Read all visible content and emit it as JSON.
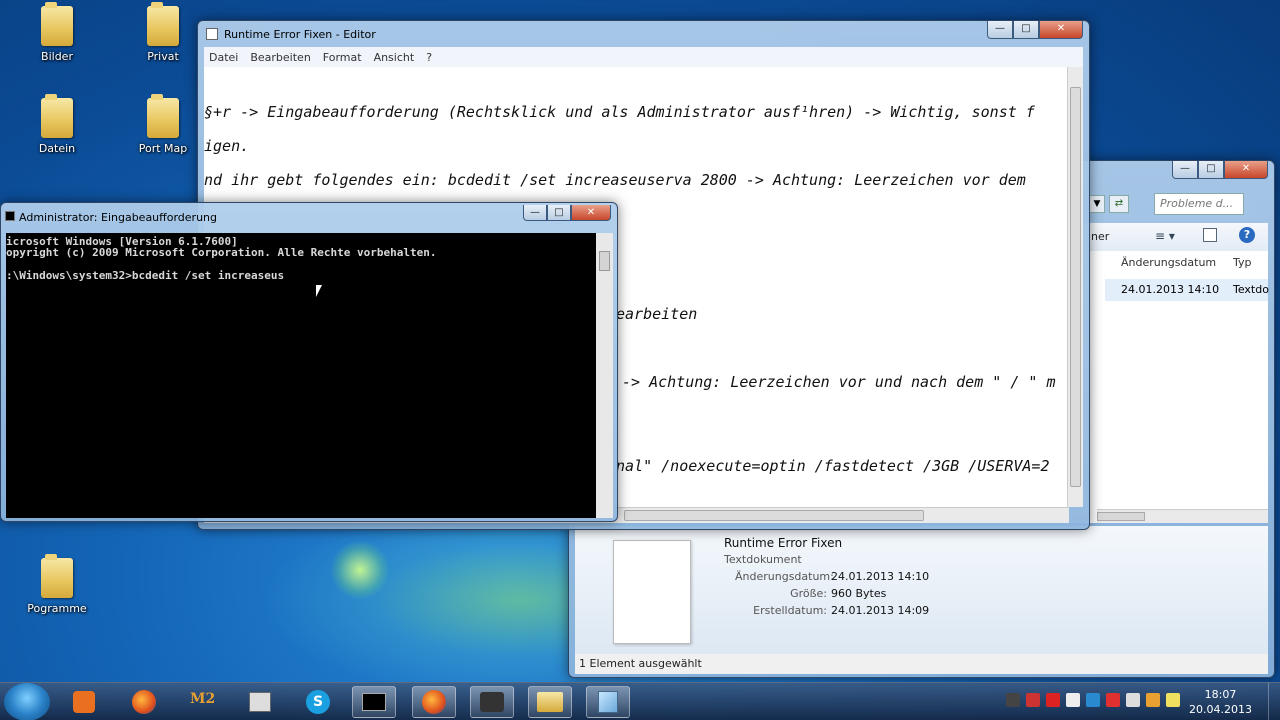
{
  "desktop": {
    "icons": [
      {
        "label": "Bilder"
      },
      {
        "label": "Privat"
      },
      {
        "label": "Datein"
      },
      {
        "label": "Port Map"
      },
      {
        "label": "Pogramme"
      }
    ]
  },
  "editor": {
    "title": "Runtime Error Fixen - Editor",
    "menu": [
      "Datei",
      "Bearbeiten",
      "Format",
      "Ansicht",
      "?"
    ],
    "lines": [
      "§+r -> Eingabeaufforderung (Rechtsklick und als Administrator ausf¹hren) -> Wichtig, sonst f",
      "igen.",
      "nd ihr gebt folgendes ein: bcdedit /set increaseuserva 2800 -> Achtung: Leerzeichen vor dem",
      "earbeiten",
      "-> Achtung: Leerzeichen vor und nach dem \" / \" m",
      "nal\" /noexecute=optin /fastdetect /3GB /USERVA=2"
    ]
  },
  "console": {
    "title": "Administrator: Eingabeaufforderung",
    "lines": [
      "icrosoft Windows [Version 6.1.7600]",
      "opyright (c) 2009 Microsoft Corporation. Alle Rechte vorbehalten.",
      ":\\Windows\\system32>bcdedit /set increaseus"
    ]
  },
  "explorer": {
    "search_placeholder": "Probleme d...",
    "header_partial": "ner",
    "col_date": "Änderungsdatum",
    "col_type": "Typ",
    "row": {
      "date": "24.01.2013 14:10",
      "type": "Textdo"
    },
    "details": {
      "name": "Runtime Error Fixen",
      "kind": "Textdokument",
      "changed_label": "Änderungsdatum:",
      "changed_value": "24.01.2013 14:10",
      "size_label": "Größe:",
      "size_value": "960 Bytes",
      "created_label": "Erstelldatum:",
      "created_value": "24.01.2013 14:09"
    },
    "status": "1 Element ausgewählt"
  },
  "taskbar": {
    "time": "18:07",
    "date": "20.04.2013"
  },
  "colors": {
    "desktop": "#1466b8",
    "console_bg": "#000000",
    "close_button": "#c8462a"
  }
}
